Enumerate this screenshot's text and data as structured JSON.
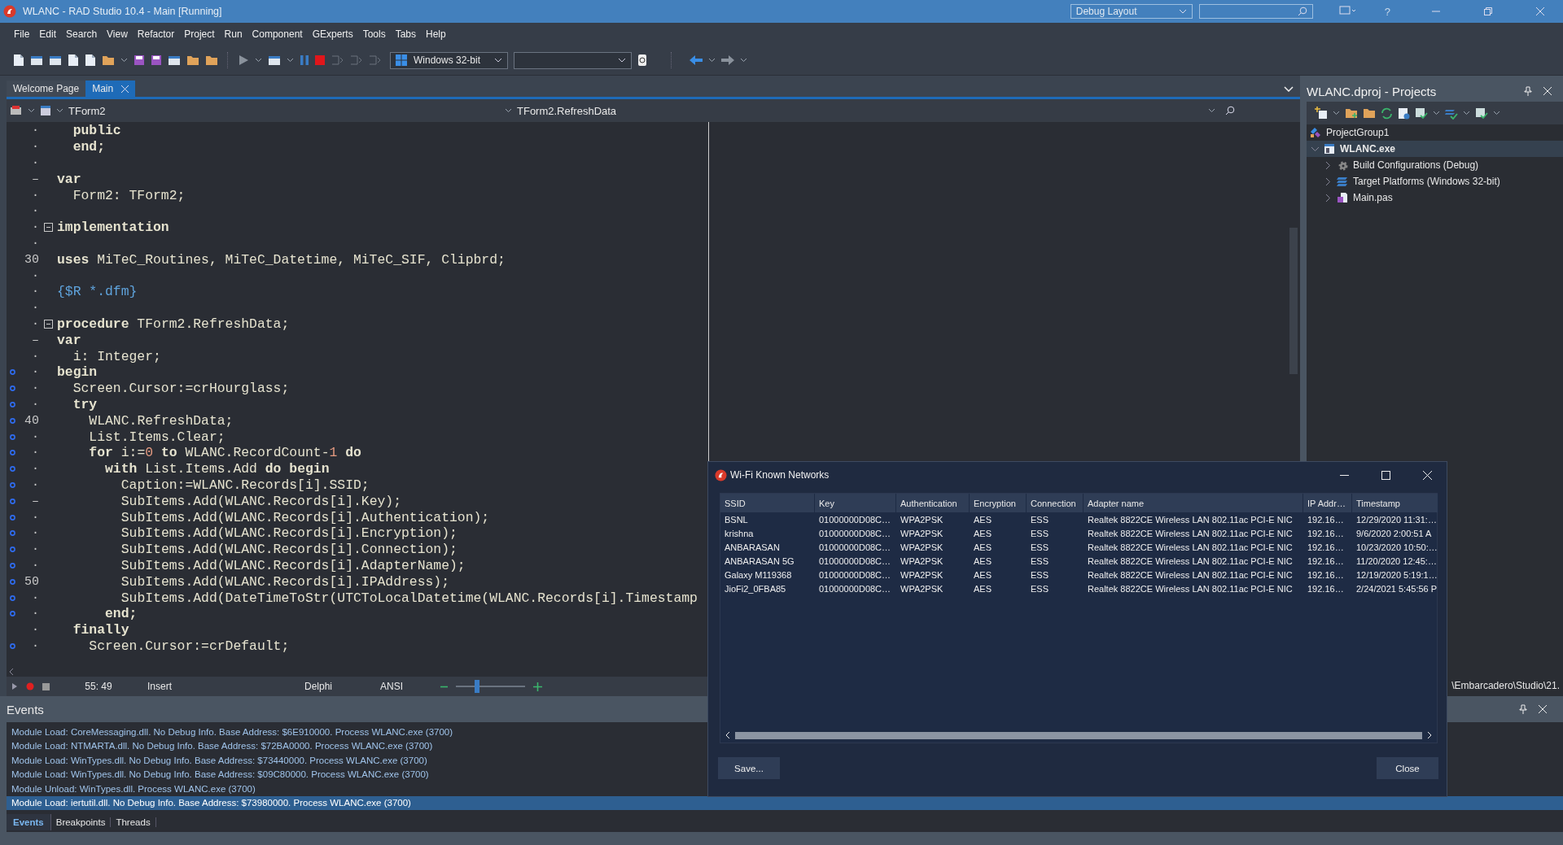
{
  "window": {
    "title": "WLANC - RAD Studio 10.4 - Main [Running]",
    "layout_dropdown": "Debug Layout",
    "help": "?"
  },
  "menu": [
    "File",
    "Edit",
    "Search",
    "View",
    "Refactor",
    "Project",
    "Run",
    "Component",
    "GExperts",
    "Tools",
    "Tabs",
    "Help"
  ],
  "toolbar": {
    "platform": "Windows 32-bit"
  },
  "tabs": [
    {
      "label": "Welcome Page",
      "selected": false
    },
    {
      "label": "Main",
      "selected": true
    }
  ],
  "editor": {
    "class_selector": "TForm2",
    "method_selector": "TForm2.RefreshData",
    "lines": [
      {
        "gutter": "·",
        "breakpoint": false,
        "fold": false,
        "segments": [
          {
            "text": "  public",
            "kind": "keyword"
          }
        ]
      },
      {
        "gutter": "·",
        "breakpoint": false,
        "fold": false,
        "segments": [
          {
            "text": "  end;",
            "kind": "keyword"
          }
        ]
      },
      {
        "gutter": "·",
        "breakpoint": false,
        "fold": false
      },
      {
        "gutter": "–",
        "breakpoint": false,
        "fold": false,
        "segments": [
          {
            "text": "var",
            "kind": "keyword"
          }
        ]
      },
      {
        "gutter": "·",
        "breakpoint": false,
        "fold": false,
        "segments": [
          {
            "text": "  Form2: TForm2;",
            "kind": "text"
          }
        ]
      },
      {
        "gutter": "·",
        "breakpoint": false,
        "fold": false
      },
      {
        "gutter": "·",
        "breakpoint": false,
        "fold": true,
        "segments": [
          {
            "text": "implementation",
            "kind": "keyword"
          }
        ]
      },
      {
        "gutter": "·",
        "breakpoint": false,
        "fold": false
      },
      {
        "gutter": "30",
        "breakpoint": false,
        "fold": false,
        "segments": [
          {
            "text": "uses",
            "kind": "keyword"
          },
          {
            "text": " MiTeC_Routines, MiTeC_Datetime, MiTeC_SIF, Clipbrd;",
            "kind": "text"
          }
        ]
      },
      {
        "gutter": "·",
        "breakpoint": false,
        "fold": false
      },
      {
        "gutter": "·",
        "breakpoint": false,
        "fold": false,
        "segments": [
          {
            "text": "{$R *.dfm}",
            "kind": "directive"
          }
        ]
      },
      {
        "gutter": "·",
        "breakpoint": false,
        "fold": false
      },
      {
        "gutter": "·",
        "breakpoint": false,
        "fold": true,
        "segments": [
          {
            "text": "procedure",
            "kind": "keyword"
          },
          {
            "text": " TForm2.RefreshData;",
            "kind": "text"
          }
        ]
      },
      {
        "gutter": "–",
        "breakpoint": false,
        "fold": false,
        "segments": [
          {
            "text": "var",
            "kind": "keyword"
          }
        ]
      },
      {
        "gutter": "·",
        "breakpoint": false,
        "fold": false,
        "segments": [
          {
            "text": "  i: Integer;",
            "kind": "text"
          }
        ]
      },
      {
        "gutter": "·",
        "breakpoint": true,
        "fold": false,
        "segments": [
          {
            "text": "begin",
            "kind": "keyword"
          }
        ]
      },
      {
        "gutter": "·",
        "breakpoint": true,
        "fold": false,
        "segments": [
          {
            "text": "  Screen.Cursor:=crHourglass;",
            "kind": "text"
          }
        ]
      },
      {
        "gutter": "·",
        "breakpoint": true,
        "fold": false,
        "segments": [
          {
            "text": "  try",
            "kind": "keyword"
          }
        ]
      },
      {
        "gutter": "40",
        "breakpoint": true,
        "fold": false,
        "segments": [
          {
            "text": "    WLANC.RefreshData;",
            "kind": "text"
          }
        ]
      },
      {
        "gutter": "·",
        "breakpoint": true,
        "fold": false,
        "segments": [
          {
            "text": "    List.Items.Clear;",
            "kind": "text"
          }
        ]
      },
      {
        "gutter": "·",
        "breakpoint": true,
        "fold": false,
        "segments": [
          {
            "text": "    for",
            "kind": "keyword"
          },
          {
            "text": " i:=",
            "kind": "text"
          },
          {
            "text": "0",
            "kind": "number"
          },
          {
            "text": " to",
            "kind": "keyword"
          },
          {
            "text": " WLANC.RecordCount-",
            "kind": "text"
          },
          {
            "text": "1",
            "kind": "number"
          },
          {
            "text": " do",
            "kind": "keyword"
          }
        ]
      },
      {
        "gutter": "·",
        "breakpoint": true,
        "fold": false,
        "segments": [
          {
            "text": "      with",
            "kind": "keyword"
          },
          {
            "text": " List.Items.Add ",
            "kind": "text"
          },
          {
            "text": "do begin",
            "kind": "keyword"
          }
        ]
      },
      {
        "gutter": "·",
        "breakpoint": true,
        "fold": false,
        "segments": [
          {
            "text": "        Caption:=WLANC.Records[i].SSID;",
            "kind": "text"
          }
        ]
      },
      {
        "gutter": "–",
        "breakpoint": true,
        "fold": false,
        "segments": [
          {
            "text": "        SubItems.Add(WLANC.Records[i].Key);",
            "kind": "text"
          }
        ]
      },
      {
        "gutter": "·",
        "breakpoint": true,
        "fold": false,
        "segments": [
          {
            "text": "        SubItems.Add(WLANC.Records[i].Authentication);",
            "kind": "text"
          }
        ]
      },
      {
        "gutter": "·",
        "breakpoint": true,
        "fold": false,
        "segments": [
          {
            "text": "        SubItems.Add(WLANC.Records[i].Encryption);",
            "kind": "text"
          }
        ]
      },
      {
        "gutter": "·",
        "breakpoint": true,
        "fold": false,
        "segments": [
          {
            "text": "        SubItems.Add(WLANC.Records[i].Connection);",
            "kind": "text"
          }
        ]
      },
      {
        "gutter": "·",
        "breakpoint": true,
        "fold": false,
        "segments": [
          {
            "text": "        SubItems.Add(WLANC.Records[i].AdapterName);",
            "kind": "text"
          }
        ]
      },
      {
        "gutter": "50",
        "breakpoint": true,
        "fold": false,
        "segments": [
          {
            "text": "        SubItems.Add(WLANC.Records[i].IPAddress);",
            "kind": "text"
          }
        ]
      },
      {
        "gutter": "·",
        "breakpoint": true,
        "fold": false,
        "segments": [
          {
            "text": "        SubItems.Add(DateTimeToStr(UTCToLocalDatetime(WLANC.Records[i].Timestamp",
            "kind": "text"
          }
        ]
      },
      {
        "gutter": "·",
        "breakpoint": true,
        "fold": false,
        "segments": [
          {
            "text": "      end;",
            "kind": "keyword"
          }
        ]
      },
      {
        "gutter": "·",
        "breakpoint": false,
        "fold": false,
        "segments": [
          {
            "text": "  finally",
            "kind": "keyword"
          }
        ]
      },
      {
        "gutter": "·",
        "breakpoint": true,
        "fold": false,
        "segments": [
          {
            "text": "    Screen.Cursor:=crDefault;",
            "kind": "text"
          }
        ]
      }
    ]
  },
  "status_bar": {
    "position": "55: 49",
    "mode": "Insert",
    "language": "Delphi",
    "encoding": "ANSI",
    "zoom": {
      "level": 0.3
    }
  },
  "projects": {
    "title": "WLANC.dproj - Projects",
    "path": "\\Embarcadero\\Studio\\21.",
    "tree": [
      {
        "label": "ProjectGroup1",
        "selected": false,
        "children": [
          {
            "label": "WLANC.exe",
            "selected": true,
            "expanded": true,
            "children": [
              {
                "label": "Build Configurations (Debug)",
                "selected": false,
                "expanded": false
              },
              {
                "label": "Target Platforms (Windows 32-bit)",
                "selected": false,
                "expanded": false
              },
              {
                "label": "Main.pas",
                "selected": false,
                "expanded": false
              }
            ]
          }
        ]
      }
    ]
  },
  "events": {
    "title": "Events",
    "items": [
      {
        "text": "Module Load: CoreMessaging.dll. No Debug Info. Base Address: $6E910000. Process WLANC.exe (3700)",
        "selected": false
      },
      {
        "text": "Module Load: NTMARTA.dll. No Debug Info. Base Address: $72BA0000. Process WLANC.exe (3700)",
        "selected": false
      },
      {
        "text": "Module Load: WinTypes.dll. No Debug Info. Base Address: $73440000. Process WLANC.exe (3700)",
        "selected": false
      },
      {
        "text": "Module Load: WinTypes.dll. No Debug Info. Base Address: $09C80000. Process WLANC.exe (3700)",
        "selected": false
      },
      {
        "text": "Module Unload: WinTypes.dll. Process WLANC.exe (3700)",
        "selected": false
      },
      {
        "text": "Module Load: iertutil.dll. No Debug Info. Base Address: $73980000. Process WLANC.exe (3700)",
        "selected": true
      }
    ],
    "tabs": [
      {
        "label": "Events",
        "selected": true
      },
      {
        "label": "Breakpoints",
        "selected": false
      },
      {
        "label": "Threads",
        "selected": false
      }
    ]
  },
  "dialog": {
    "title": "Wi-Fi Known Networks",
    "columns": [
      "SSID",
      "Key",
      "Authentication",
      "Encryption",
      "Connection",
      "Adapter name",
      "IP Addr…",
      "Timestamp"
    ],
    "rows": [
      [
        "BSNL",
        "01000000D08C…",
        "WPA2PSK",
        "AES",
        "ESS",
        "Realtek 8822CE Wireless LAN 802.11ac PCI-E NIC",
        "192.16…",
        "12/29/2020 11:31:…"
      ],
      [
        "krishna",
        "01000000D08C…",
        "WPA2PSK",
        "AES",
        "ESS",
        "Realtek 8822CE Wireless LAN 802.11ac PCI-E NIC",
        "192.16…",
        "9/6/2020 2:00:51 A"
      ],
      [
        "ANBARASAN",
        "01000000D08C…",
        "WPA2PSK",
        "AES",
        "ESS",
        "Realtek 8822CE Wireless LAN 802.11ac PCI-E NIC",
        "192.16…",
        "10/23/2020 10:50:…"
      ],
      [
        "ANBARASAN 5G",
        "01000000D08C…",
        "WPA2PSK",
        "AES",
        "ESS",
        "Realtek 8822CE Wireless LAN 802.11ac PCI-E NIC",
        "192.16…",
        "11/20/2020 12:45:…"
      ],
      [
        "Galaxy M119368",
        "01000000D08C…",
        "WPA2PSK",
        "AES",
        "ESS",
        "Realtek 8822CE Wireless LAN 802.11ac PCI-E NIC",
        "192.16…",
        "12/19/2020 5:19:1…"
      ],
      [
        "JioFi2_0FBA85",
        "01000000D08C…",
        "WPA2PSK",
        "AES",
        "ESS",
        "Realtek 8822CE Wireless LAN 802.11ac PCI-E NIC",
        "192.16…",
        "2/24/2021 5:45:56 P"
      ]
    ],
    "buttons": [
      "Save...",
      "Close"
    ]
  }
}
